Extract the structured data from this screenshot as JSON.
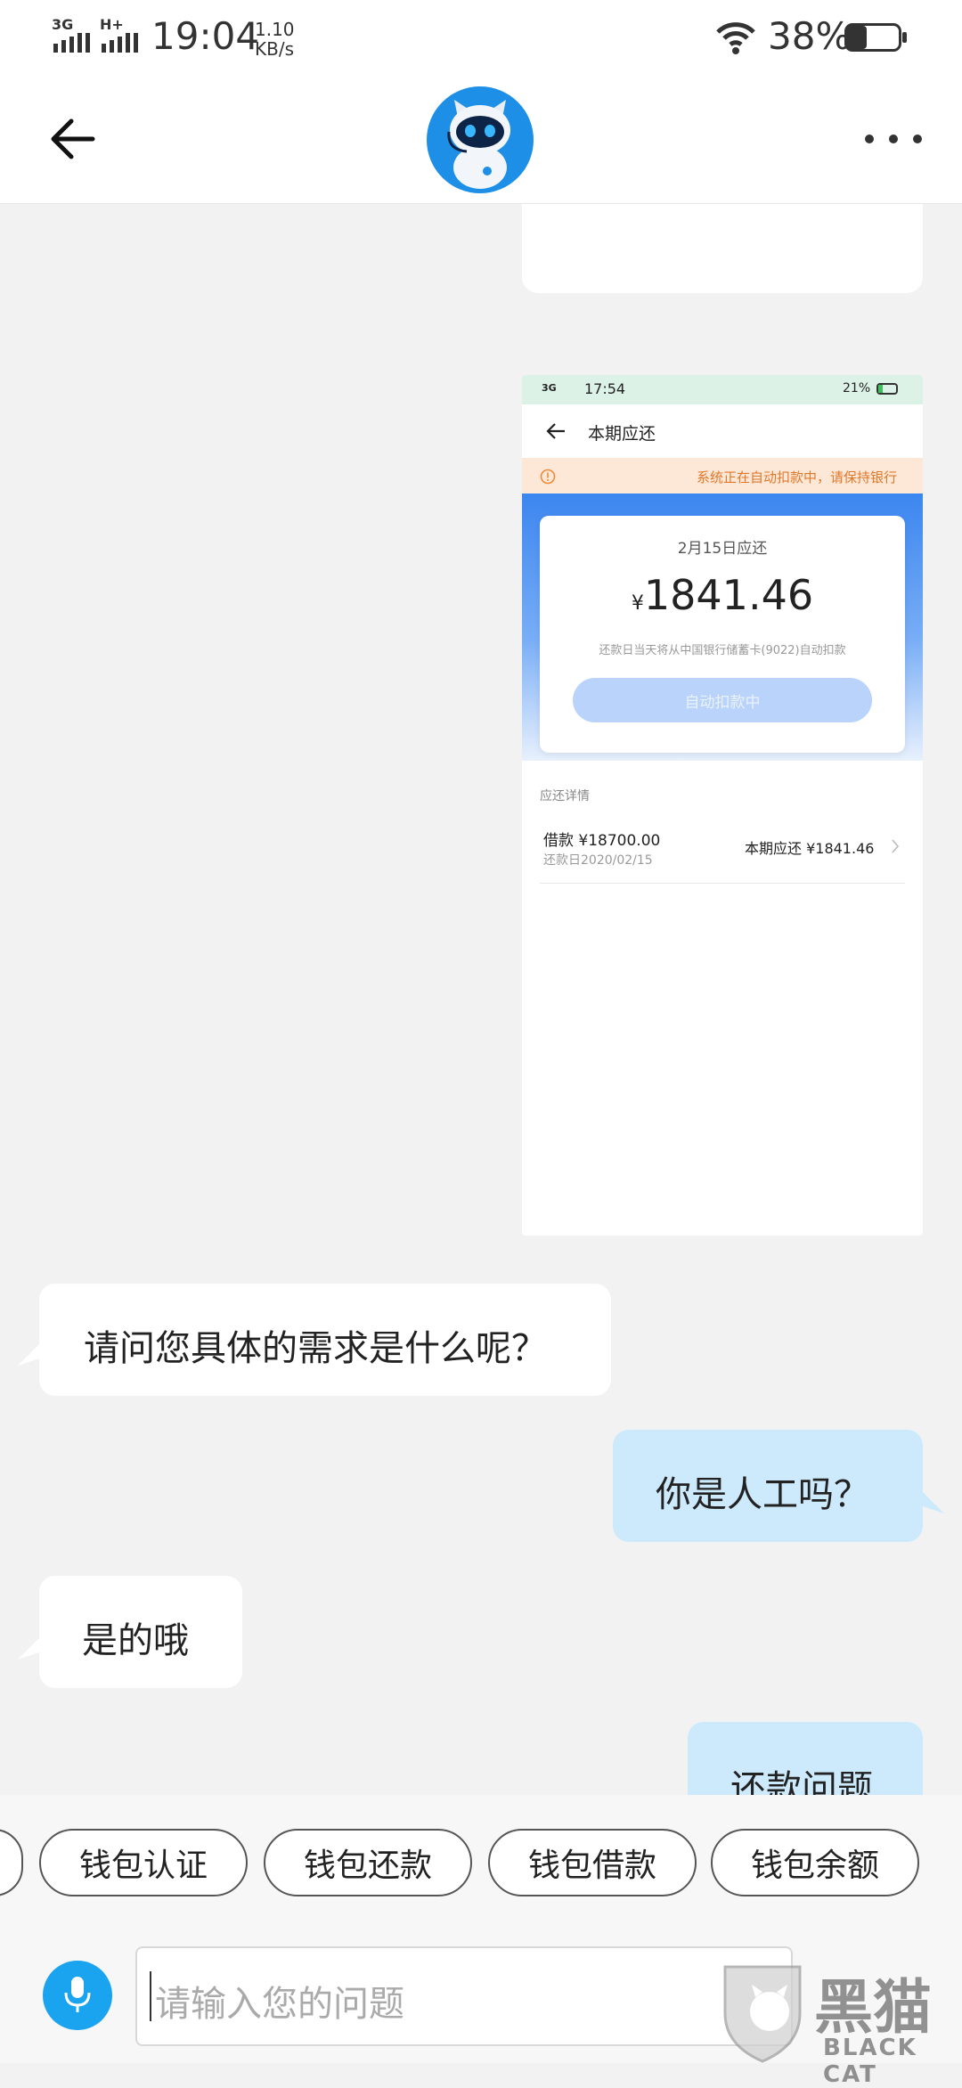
{
  "status_bar": {
    "network1": "3G",
    "network2": "H+",
    "time": "19:04",
    "speed_value": "1.10",
    "speed_unit": "KB/s",
    "battery": "38%",
    "battery_level": 0.38
  },
  "header": {
    "back_icon": "arrow-left-icon",
    "avatar_icon": "robot-avatar-icon",
    "more_icon": "more-dots-icon"
  },
  "embedded_screenshot": {
    "status": {
      "net": "3G",
      "time": "17:54",
      "battery": "21%"
    },
    "title": "本期应还",
    "notice": "系统正在自动扣款中，请保持银行",
    "due_date": "2月15日应还",
    "currency": "¥",
    "amount": "1841.46",
    "debit_note": "还款日当天将从中国银行储蓄卡(9022)自动扣款",
    "auto_debit_button": "自动扣款中",
    "detail_header": "应还详情",
    "loan_label": "借款 ¥18700.00",
    "repay_date": "还款日2020/02/15",
    "period_due": "本期应还 ¥1841.46"
  },
  "messages": [
    {
      "side": "left",
      "text": "请问您具体的需求是什么呢？"
    },
    {
      "side": "right",
      "text": "你是人工吗？"
    },
    {
      "side": "left",
      "text": "是的哦"
    },
    {
      "side": "right",
      "text": "还款问题"
    }
  ],
  "quick_replies": [
    "钱包认证",
    "钱包还款",
    "钱包借款",
    "钱包余额"
  ],
  "input": {
    "placeholder": "请输入您的问题",
    "mic_icon": "microphone-icon"
  },
  "watermark": {
    "text_cn": "黑猫",
    "text_en": "BLACK CAT"
  }
}
